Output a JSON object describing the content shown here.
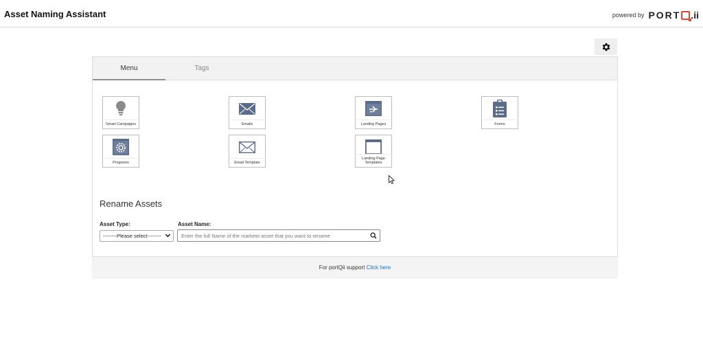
{
  "header": {
    "title": "Asset Naming Assistant",
    "powered_by": "powered by",
    "brand_prefix": "PORT",
    "brand_suffix": ".ii"
  },
  "colors": {
    "brand_accent": "#e8452c",
    "icon_fill": "#5b6b8a",
    "link": "#1a73c8"
  },
  "tabs": [
    {
      "label": "Menu",
      "active": true
    },
    {
      "label": "Tags",
      "active": false
    }
  ],
  "tiles": [
    {
      "label": "Smart Campaigns",
      "icon": "lightbulb-icon"
    },
    {
      "label": "Emails",
      "icon": "envelope-icon"
    },
    {
      "label": "Landing Pages",
      "icon": "landing-page-icon"
    },
    {
      "label": "Forms",
      "icon": "clipboard-icon"
    },
    {
      "label": "Programs",
      "icon": "program-gear-icon"
    },
    {
      "label": "Email Template",
      "icon": "envelope-outline-icon"
    },
    {
      "label": "Landing Page Templates",
      "icon": "browser-window-icon"
    }
  ],
  "rename": {
    "title": "Rename Assets",
    "asset_type_label": "Asset Type:",
    "asset_type_value": "--------Please select--------",
    "asset_name_label": "Asset Name:",
    "asset_name_placeholder": "Enter the full Name of the marketo asset that you want to rename"
  },
  "footer": {
    "text": "For portQii support",
    "link": "Click here"
  }
}
